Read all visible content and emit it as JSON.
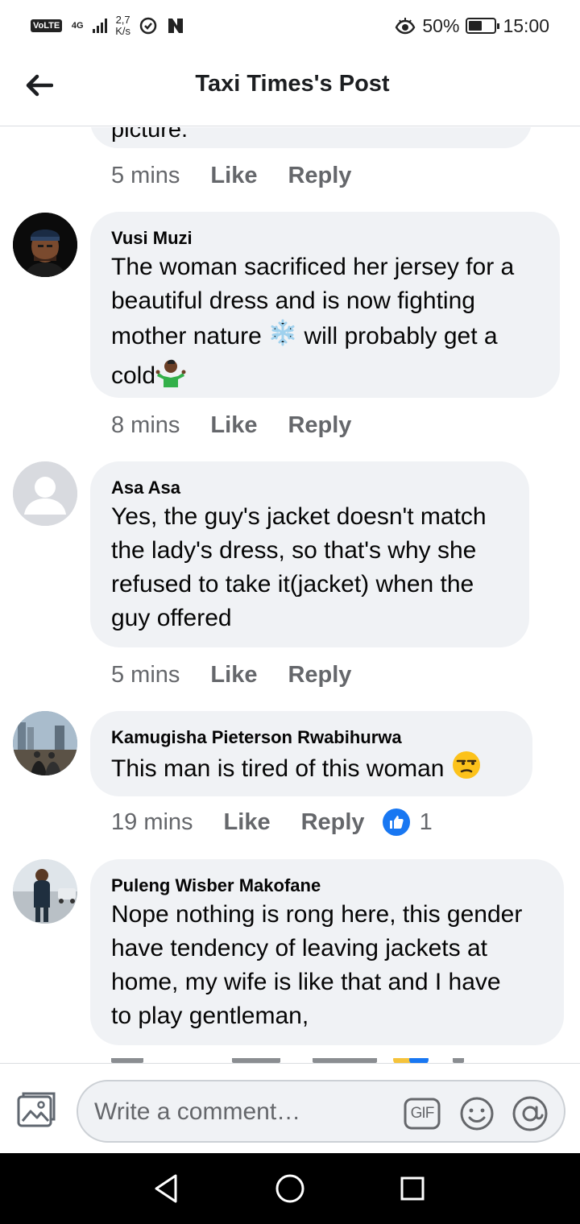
{
  "status_bar": {
    "volte": "VoLTE",
    "network": "4G",
    "speed_value": "2,7",
    "speed_unit": "K/s",
    "battery": "50%",
    "time": "15:00"
  },
  "header": {
    "title": "Taxi Times's Post"
  },
  "previous_comment": {
    "text_tail": "picture.",
    "time": "5 mins",
    "like_label": "Like",
    "reply_label": "Reply"
  },
  "comments": [
    {
      "author": "Vusi Muzi",
      "lines": [
        "The woman sacrificed her jersey for a",
        "beautiful dress and is now fighting",
        "mother nature",
        "will probably get a",
        "cold"
      ],
      "time": "8 mins",
      "like_label": "Like",
      "reply_label": "Reply"
    },
    {
      "author": "Asa Asa",
      "lines": [
        "Yes, the guy's jacket doesn't match",
        "the lady's dress, so that's why she",
        "refused to take it(jacket) when the",
        "guy offered"
      ],
      "time": "5 mins",
      "like_label": "Like",
      "reply_label": "Reply"
    },
    {
      "author": "Kamugisha Pieterson Rwabihurwa",
      "lines": [
        "This man is tired of this woman"
      ],
      "time": "19 mins",
      "like_label": "Like",
      "reply_label": "Reply",
      "reaction_count": "1"
    },
    {
      "author": "Puleng Wisber Makofane",
      "lines": [
        "Nope nothing is rong here, this gender",
        "have tendency of leaving jackets at",
        "home, my wife is like that and I have",
        "to play gentleman,"
      ]
    }
  ],
  "composer": {
    "placeholder": "Write a comment…",
    "gif_label": "GIF"
  },
  "colors": {
    "bubble": "#f0f2f5",
    "meta_text": "#65676b",
    "like_blue": "#1877f2"
  }
}
